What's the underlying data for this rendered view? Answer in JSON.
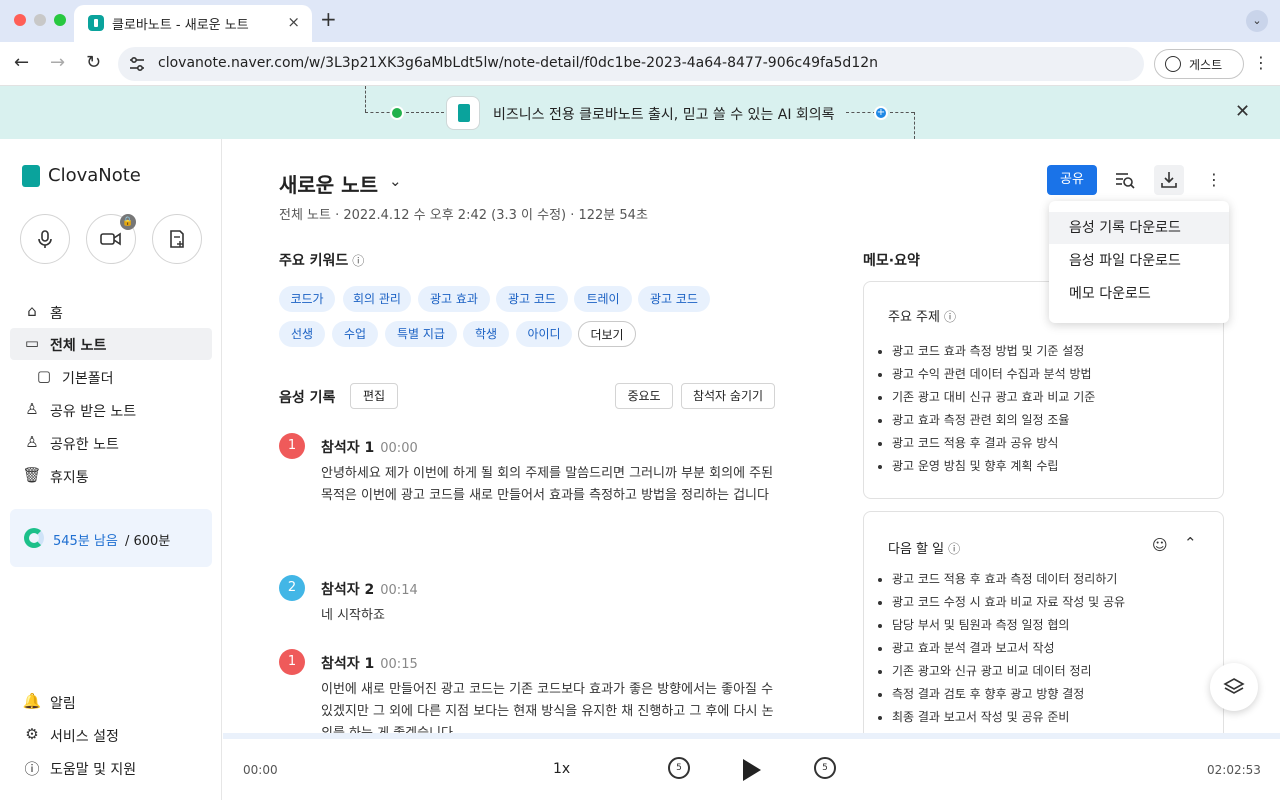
{
  "browser": {
    "tab_title": "클로바노트 - 새로운 노트",
    "url": "clovanote.naver.com/w/3L3p21XK3g6aMbLdt5lw/note-detail/f0dc1be-2023-4a64-8477-906c49fa5d12n",
    "guest_label": "게스트",
    "new_tab": "+",
    "close_tab": "×"
  },
  "banner": {
    "text": "비즈니스 전용 클로바노트 출시, 믿고 쓸 수 있는 AI 회의록"
  },
  "sidebar": {
    "logo": "ClovaNote",
    "nav": [
      {
        "label": "홈",
        "icon": "home-icon"
      },
      {
        "label": "전체 노트",
        "icon": "inbox-icon"
      },
      {
        "label": "기본폴더",
        "icon": "folder-icon"
      },
      {
        "label": "공유 받은 노트",
        "icon": "person-icon"
      },
      {
        "label": "공유한 노트",
        "icon": "person-share-icon"
      },
      {
        "label": "휴지통",
        "icon": "trash-icon"
      }
    ],
    "quota_remaining": "545분 남음",
    "quota_total": "/ 600분",
    "bottom": [
      {
        "label": "알림",
        "icon": "bell-icon"
      },
      {
        "label": "서비스 설정",
        "icon": "gear-icon"
      },
      {
        "label": "도움말 및 지원",
        "icon": "help-icon"
      }
    ]
  },
  "note": {
    "title": "새로운 노트",
    "meta": "전체 노트 · 2022.4.12 수 오후 2:42 (3.3 이 수정) · 122분 54초",
    "share_label": "공유"
  },
  "keywords": {
    "heading": "주요 키워드",
    "chips": [
      "코드가",
      "회의 관리",
      "광고 효과",
      "광고 코드",
      "트레이",
      "광고 코드",
      "선생",
      "수업",
      "특별 지급",
      "학생",
      "아이디",
      "더보기"
    ]
  },
  "transcript": {
    "heading": "음성 기록",
    "edit_label": "편집",
    "btn1_label": "중요도",
    "btn2_label": "참석자 숨기기",
    "entries": [
      {
        "num": "1",
        "speaker": "참석자 1",
        "time": "00:00",
        "text": "안녕하세요 제가 이번에 하게 될 회의 주제를 말씀드리면 그러니까 부분 회의에 주된 목적은 이번에 광고 코드를 새로 만들어서 효과를 측정하고 방법을 정리하는 겁니다"
      },
      {
        "num": "2",
        "speaker": "참석자 2",
        "time": "00:14",
        "text": "네 시작하죠"
      },
      {
        "num": "1",
        "speaker": "참석자 1",
        "time": "00:15",
        "text": "이번에 새로 만들어진 광고 코드는 기존 코드보다 효과가 좋은 방향에서는 좋아질 수 있겠지만 그 외에 다른 지점 보다는 현재 방식을 유지한 채 진행하고 그 후에 다시 논의를 하는 게 좋겠습니다"
      }
    ]
  },
  "memo": {
    "heading": "메모·요약",
    "topics": {
      "title": "주요 주제",
      "items": [
        "광고 코드 효과 측정 방법 및 기준 설정",
        "광고 수익 관련 데이터 수집과 분석 방법",
        "기존 광고 대비 신규 광고 효과 비교 기준",
        "광고 효과 측정 관련 회의 일정 조율",
        "광고 코드 적용 후 결과 공유 방식",
        "광고 운영 방침 및 향후 계획 수립"
      ]
    },
    "todos": {
      "title": "다음 할 일",
      "items": [
        "광고 코드 적용 후 효과 측정 데이터 정리하기",
        "광고 코드 수정 시 효과 비교 자료 작성 및 공유",
        "담당 부서 및 팀원과 측정 일정 협의",
        "광고 효과 분석 결과 보고서 작성",
        "기존 광고와 신규 광고 비교 데이터 정리",
        "측정 결과 검토 후 향후 광고 방향 결정",
        "최종 결과 보고서 작성 및 공유 준비"
      ]
    }
  },
  "download_menu": [
    "음성 기록 다운로드",
    "음성 파일 다운로드",
    "메모 다운로드"
  ],
  "player": {
    "current": "00:00",
    "speed": "1x",
    "total": "02:02:53",
    "skip_back": "5",
    "skip_fwd": "5"
  }
}
